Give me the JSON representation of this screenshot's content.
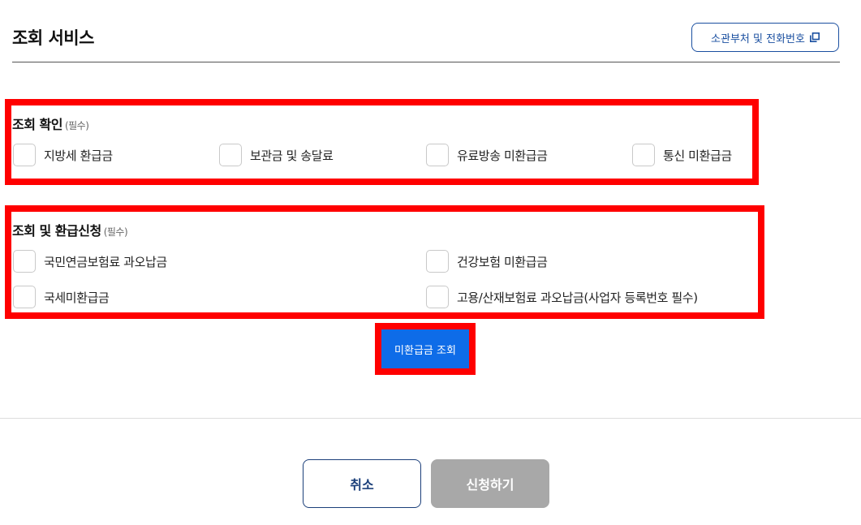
{
  "header": {
    "title": "조회 서비스",
    "dept_button_label": "소관부처 및 전화번호",
    "dept_button_icon": "external-link-icon"
  },
  "check_section": {
    "title": "조회 확인",
    "required_note": "(필수)",
    "options": [
      {
        "label": "지방세 환급금",
        "checked": false
      },
      {
        "label": "보관금 및 송달료",
        "checked": false
      },
      {
        "label": "유료방송 미환급금",
        "checked": false
      },
      {
        "label": "통신 미환급금",
        "checked": false
      }
    ]
  },
  "refund_section": {
    "title": "조회 및 환급신청",
    "required_note": "(필수)",
    "options": [
      {
        "label": "국민연금보험료 과오납금",
        "checked": false
      },
      {
        "label": "건강보험 미환급금",
        "checked": false
      },
      {
        "label": "국세미환급금",
        "checked": false
      },
      {
        "label": "고용/산재보험료 과오납금(사업자 등록번호 필수)",
        "checked": false
      }
    ]
  },
  "search_button_label": "미환급금 조회",
  "footer": {
    "cancel_label": "취소",
    "apply_label": "신청하기"
  },
  "colors": {
    "highlight_border": "#ff0000",
    "primary_blue": "#0e6ce8",
    "navy": "#1b3f7a",
    "disabled_gray": "#a8a8a8"
  }
}
